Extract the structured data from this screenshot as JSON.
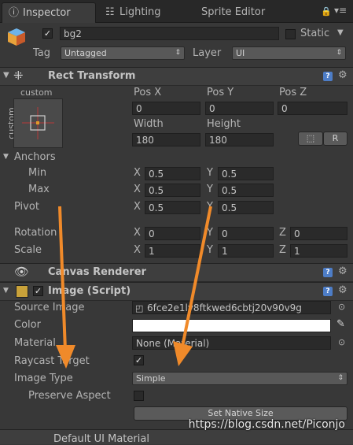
{
  "tabs": {
    "inspector": "Inspector",
    "lighting": "Lighting",
    "sprite_editor": "Sprite Editor"
  },
  "object": {
    "name": "bg2",
    "static_label": "Static",
    "tag_label": "Tag",
    "tag_value": "Untagged",
    "layer_label": "Layer",
    "layer_value": "UI"
  },
  "rect_transform": {
    "title": "Rect Transform",
    "anchor_preset_top": "custom",
    "anchor_preset_side": "custom",
    "pos_x_label": "Pos X",
    "pos_y_label": "Pos Y",
    "pos_z_label": "Pos Z",
    "pos_x": "0",
    "pos_y": "0",
    "pos_z": "0",
    "width_label": "Width",
    "height_label": "Height",
    "width": "180",
    "height": "180",
    "r_button": "R",
    "anchors_label": "Anchors",
    "min_label": "Min",
    "max_label": "Max",
    "min_x": "0.5",
    "min_y": "0.5",
    "max_x": "0.5",
    "max_y": "0.5",
    "pivot_label": "Pivot",
    "pivot_x": "0.5",
    "pivot_y": "0.5",
    "rotation_label": "Rotation",
    "rot_x": "0",
    "rot_y": "0",
    "rot_z": "0",
    "scale_label": "Scale",
    "scale_x": "1",
    "scale_y": "1",
    "scale_z": "1",
    "axis_x": "X",
    "axis_y": "Y",
    "axis_z": "Z"
  },
  "canvas_renderer": {
    "title": "Canvas Renderer"
  },
  "image": {
    "title": "Image (Script)",
    "source_image_label": "Source Image",
    "source_image_value": "6fce2e1ly8ftkwed6cbtj20v90v9g",
    "color_label": "Color",
    "material_label": "Material",
    "material_value": "None (Material)",
    "raycast_label": "Raycast Target",
    "image_type_label": "Image Type",
    "image_type_value": "Simple",
    "preserve_aspect_label": "Preserve Aspect",
    "set_native_size": "Set Native Size"
  },
  "bottom": {
    "material_header": "Default UI Material"
  },
  "watermark": "https://blog.csdn.net/Piconjo",
  "colors": {
    "annotation_arrow": "#f08a2a",
    "help_icon": "#4d7dc7"
  }
}
